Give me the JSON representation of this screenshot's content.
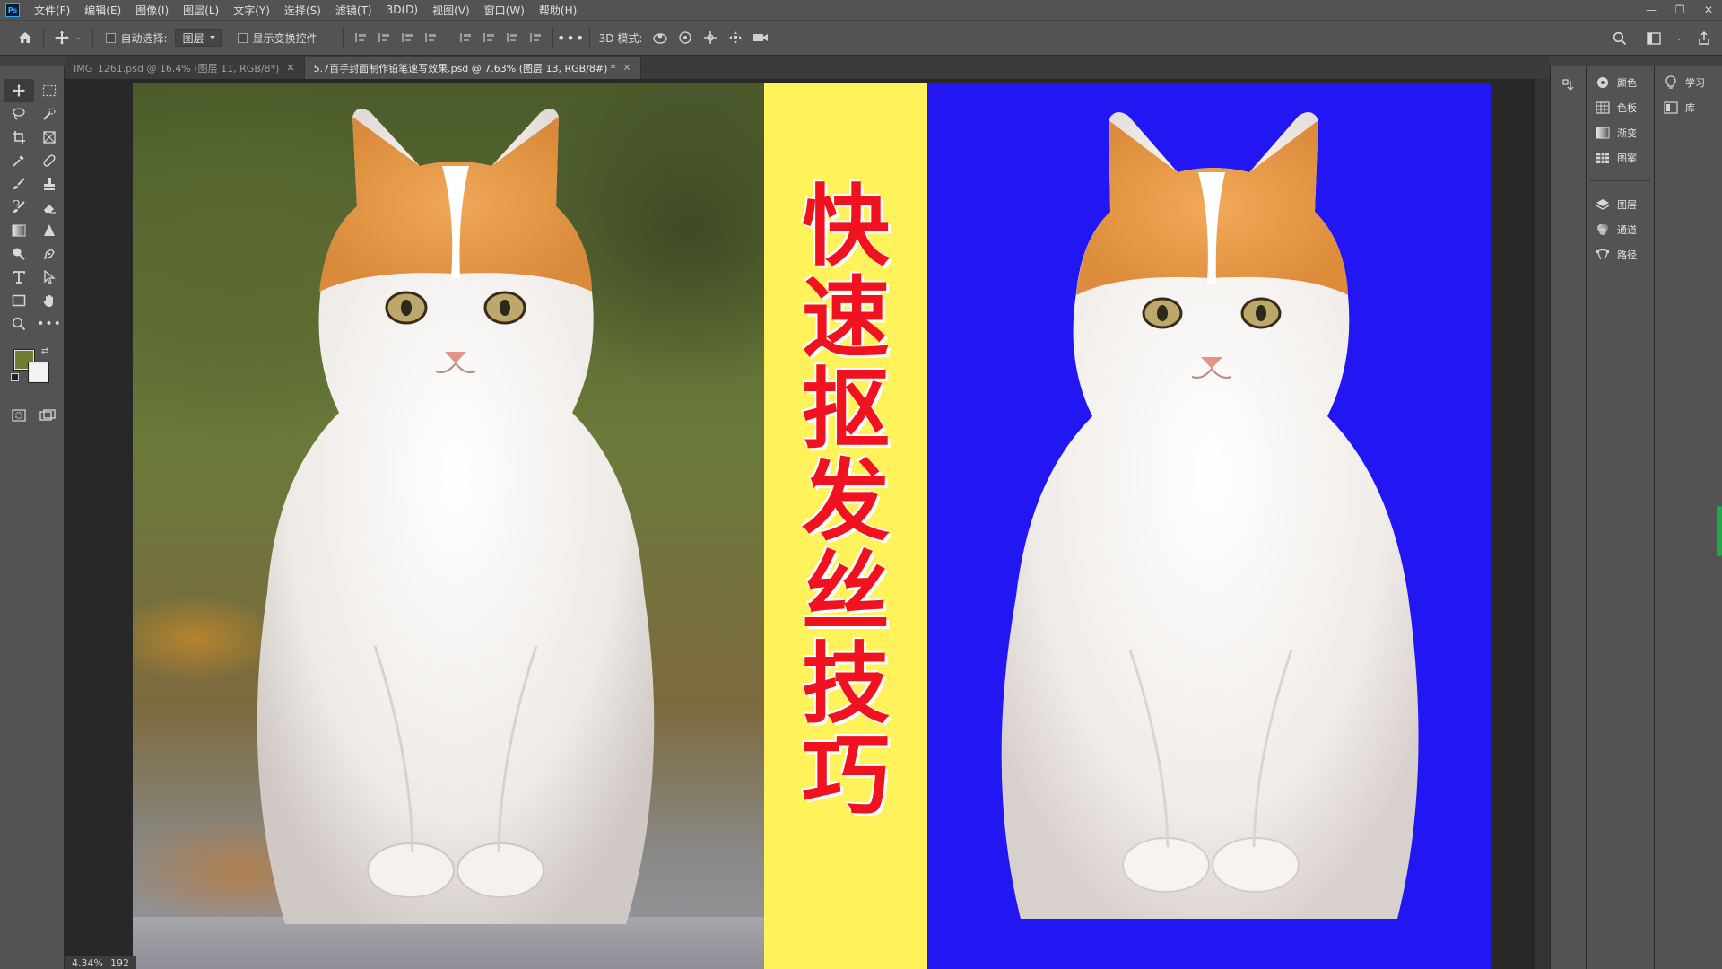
{
  "menu": {
    "items": [
      "文件(F)",
      "编辑(E)",
      "图像(I)",
      "图层(L)",
      "文字(Y)",
      "选择(S)",
      "滤镜(T)",
      "3D(D)",
      "视图(V)",
      "窗口(W)",
      "帮助(H)"
    ]
  },
  "options": {
    "auto_select_label": "自动选择:",
    "auto_select_value": "图层",
    "show_transform_label": "显示变换控件",
    "mode_3d_label": "3D 模式:"
  },
  "tabs": [
    {
      "label": "IMG_1261.psd @ 16.4% (图层 11, RGB/8*)",
      "active": false
    },
    {
      "label": "5.7百手封面制作铅笔速写效果.psd @ 7.63% (图层 13, RGB/8#) *",
      "active": true
    }
  ],
  "canvas": {
    "title_chars": [
      "快",
      "速",
      "抠",
      "发",
      "丝",
      "技",
      "巧"
    ],
    "title_color": "#f0121e",
    "band_yellow": "#fff25a",
    "band_blue": "#2217f2"
  },
  "status": {
    "zoom": "4.34%",
    "extra": "192"
  },
  "colors": {
    "foreground": "#717c33",
    "background": "#f2f2f2"
  },
  "panels": {
    "group1": [
      "颜色",
      "色板",
      "渐变",
      "图案"
    ],
    "group2": [
      "图层",
      "通道",
      "路径"
    ],
    "learn": [
      "学习",
      "库"
    ]
  }
}
